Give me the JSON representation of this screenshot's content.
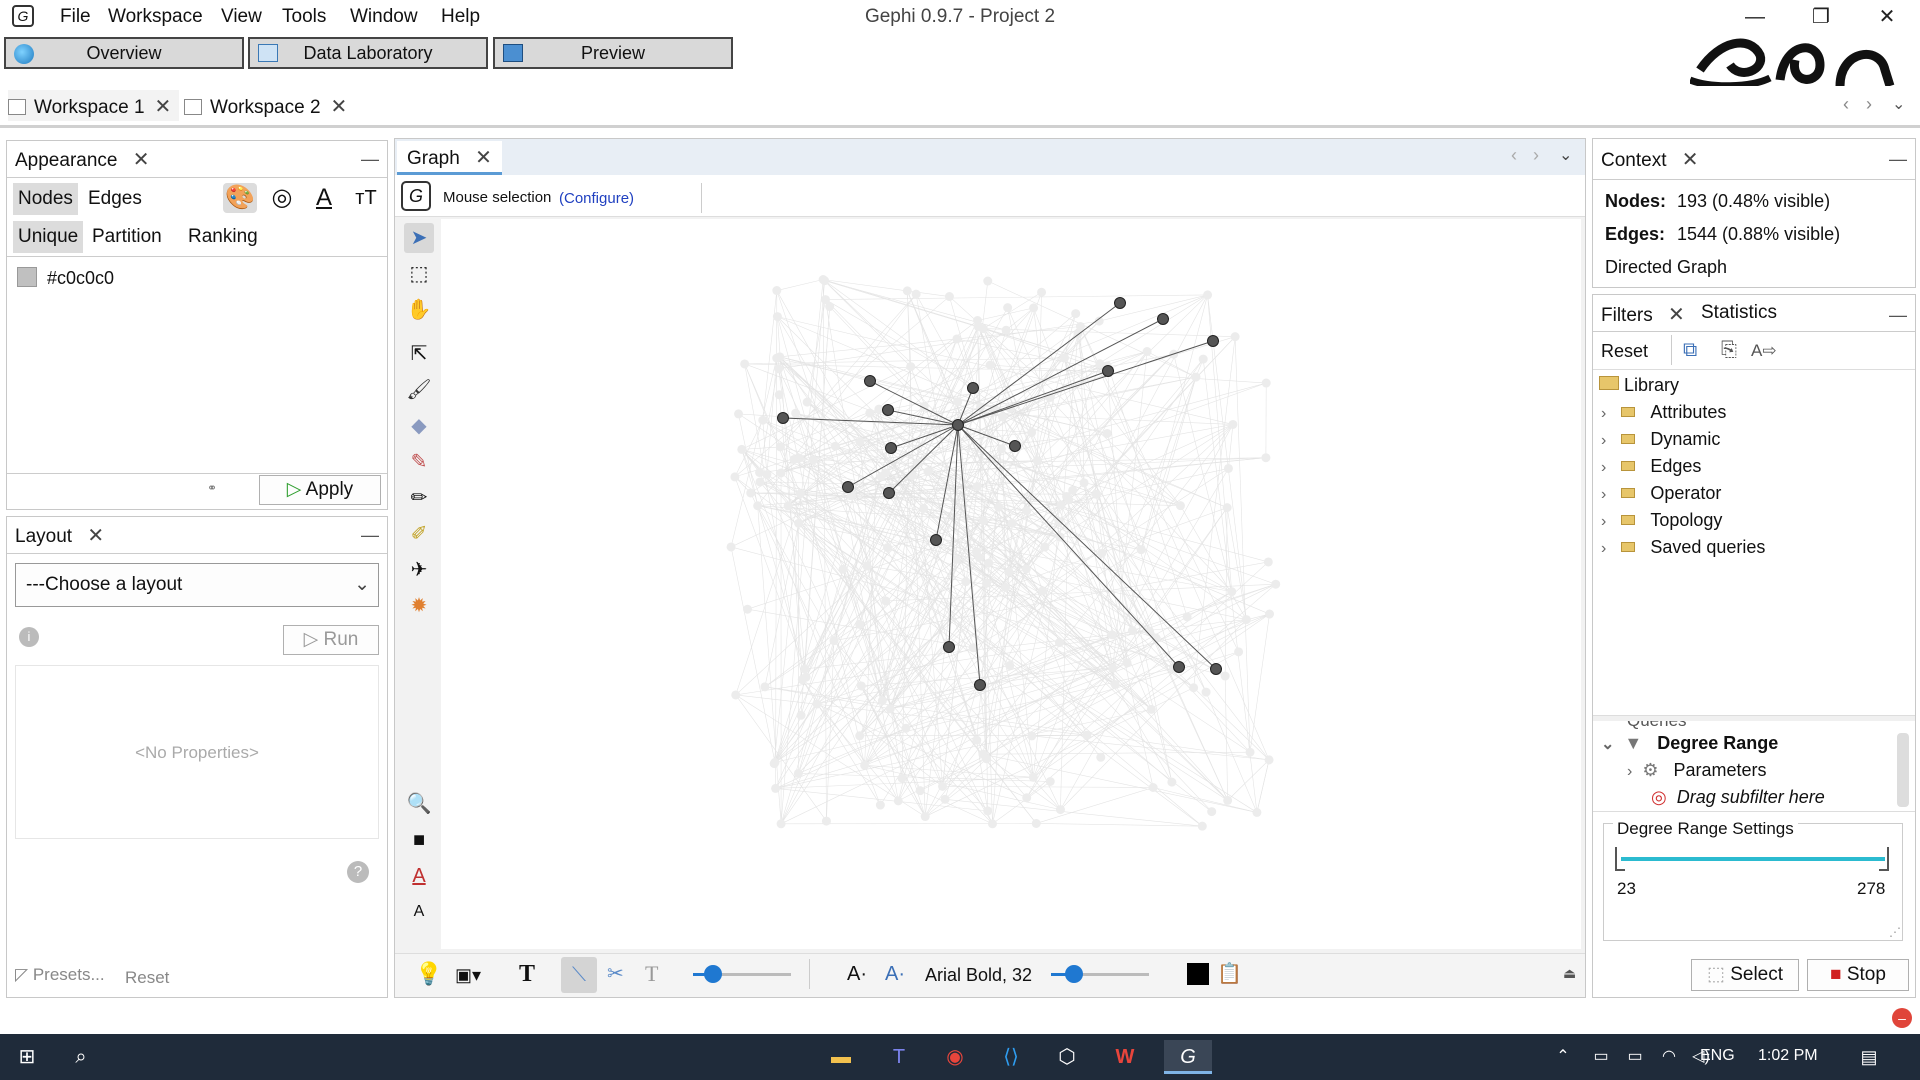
{
  "window": {
    "title": "Gephi 0.9.7 - Project 2",
    "menu": [
      "File",
      "Workspace",
      "View",
      "Tools",
      "Window",
      "Help"
    ],
    "controls": [
      "—",
      "❐",
      "✕"
    ]
  },
  "modes": [
    "Overview",
    "Data Laboratory",
    "Preview"
  ],
  "workspaces": [
    "Workspace 1",
    "Workspace 2"
  ],
  "appearance": {
    "title": "Appearance",
    "tabs": [
      "Nodes",
      "Edges"
    ],
    "subtabs": [
      "Unique",
      "Partition",
      "Ranking"
    ],
    "color_value": "#c0c0c0",
    "apply_label": "Apply"
  },
  "layout_panel": {
    "title": "Layout",
    "select_value": "---Choose a layout",
    "run_label": "Run",
    "no_props": "<No Properties>",
    "presets_label": "Presets...",
    "reset_label": "Reset"
  },
  "graph": {
    "tab": "Graph",
    "mouse_selection": "Mouse selection",
    "configure": "(Configure)",
    "font_label": "Arial Bold, 32",
    "edge_color": "#555555",
    "node_color": "#555555",
    "faded_color": "#e4e4e4"
  },
  "context": {
    "title": "Context",
    "nodes_label": "Nodes:",
    "nodes_value": "193 (0.48% visible)",
    "edges_label": "Edges:",
    "edges_value": "1544 (0.88% visible)",
    "graph_type": "Directed Graph"
  },
  "filters": {
    "tabs": [
      "Filters",
      "Statistics"
    ],
    "reset_label": "Reset",
    "library": "Library",
    "library_items": [
      "Attributes",
      "Dynamic",
      "Edges",
      "Operator",
      "Topology",
      "Saved queries"
    ],
    "queries_label": "Queries",
    "degree_range": "Degree Range",
    "parameters": "Parameters",
    "drag_subfilter": "Drag subfilter here",
    "settings_title": "Degree Range Settings",
    "range_min": "23",
    "range_max": "278",
    "select_label": "Select",
    "stop_label": "Stop"
  },
  "taskbar": {
    "lang": "ENG",
    "time": "1:02 PM"
  }
}
